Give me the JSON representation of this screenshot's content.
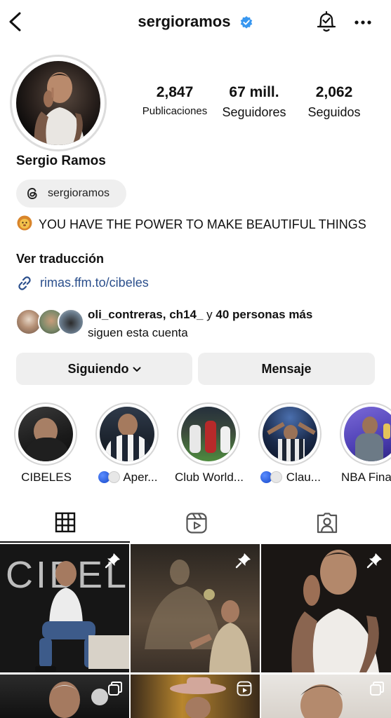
{
  "header": {
    "username": "sergioramos",
    "back_icon": "chevron-left-icon",
    "verified_icon": "verified-badge-icon",
    "bell_icon": "notification-bell-icon",
    "more_icon": "more-dots-icon"
  },
  "profile": {
    "name": "Sergio Ramos",
    "stats": [
      {
        "value": "2,847",
        "label": "Publicaciones"
      },
      {
        "value": "67 mill.",
        "label": "Seguidores"
      },
      {
        "value": "2,062",
        "label": "Seguidos"
      }
    ],
    "threads_handle": "sergioramos",
    "bio": "YOU HAVE THE POWER TO MAKE BEAUTIFUL THINGS",
    "translate": "Ver traducción",
    "link": "rimas.ffm.to/cibeles"
  },
  "mutual": {
    "names": "oli_contreras, ch14_",
    "connector": " y ",
    "count": "40 personas más",
    "suffix": "siguen esta cuenta"
  },
  "actions": {
    "following": "Siguiendo",
    "message": "Mensaje"
  },
  "highlights": [
    {
      "label": "CIBELES",
      "dots": false
    },
    {
      "label": "Aper...",
      "dots": true
    },
    {
      "label": "Club World...",
      "dots": false
    },
    {
      "label": "Clau...",
      "dots": true
    },
    {
      "label": "NBA Fina",
      "dots": false
    }
  ],
  "tabs": [
    {
      "name": "grid-tab",
      "icon": "grid-icon",
      "active": true
    },
    {
      "name": "reels-tab",
      "icon": "reels-icon",
      "active": false
    },
    {
      "name": "tagged-tab",
      "icon": "tagged-person-icon",
      "active": false
    }
  ],
  "posts": {
    "cibeles_title": "CIBELES",
    "pinned_icon": "pin-icon",
    "multiple_icon": "carousel-icon"
  },
  "colors": {
    "link": "#2b4f8c",
    "verified": "#3897f0",
    "button_bg": "#efefef"
  }
}
